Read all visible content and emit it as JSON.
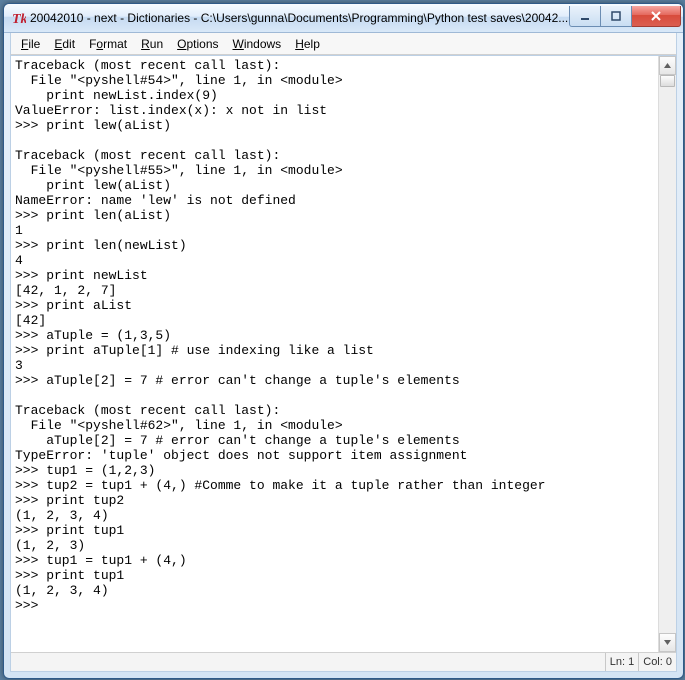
{
  "window": {
    "title": "20042010 - next - Dictionaries - C:\\Users\\gunna\\Documents\\Programming\\Python test saves\\20042..."
  },
  "menubar": {
    "items": [
      {
        "label": "File",
        "accel": "F"
      },
      {
        "label": "Edit",
        "accel": "E"
      },
      {
        "label": "Format",
        "accel": "o"
      },
      {
        "label": "Run",
        "accel": "R"
      },
      {
        "label": "Options",
        "accel": "O"
      },
      {
        "label": "Windows",
        "accel": "W"
      },
      {
        "label": "Help",
        "accel": "H"
      }
    ]
  },
  "editor": {
    "content": "Traceback (most recent call last):\n  File \"<pyshell#54>\", line 1, in <module>\n    print newList.index(9)\nValueError: list.index(x): x not in list\n>>> print lew(aList)\n\nTraceback (most recent call last):\n  File \"<pyshell#55>\", line 1, in <module>\n    print lew(aList)\nNameError: name 'lew' is not defined\n>>> print len(aList)\n1\n>>> print len(newList)\n4\n>>> print newList\n[42, 1, 2, 7]\n>>> print aList\n[42]\n>>> aTuple = (1,3,5)\n>>> print aTuple[1] # use indexing like a list\n3\n>>> aTuple[2] = 7 # error can't change a tuple's elements\n\nTraceback (most recent call last):\n  File \"<pyshell#62>\", line 1, in <module>\n    aTuple[2] = 7 # error can't change a tuple's elements\nTypeError: 'tuple' object does not support item assignment\n>>> tup1 = (1,2,3)\n>>> tup2 = tup1 + (4,) #Comme to make it a tuple rather than integer\n>>> print tup2\n(1, 2, 3, 4)\n>>> print tup1\n(1, 2, 3)\n>>> tup1 = tup1 + (4,)\n>>> print tup1\n(1, 2, 3, 4)\n>>> "
  },
  "statusbar": {
    "line": "Ln: 1",
    "col": "Col: 0"
  }
}
